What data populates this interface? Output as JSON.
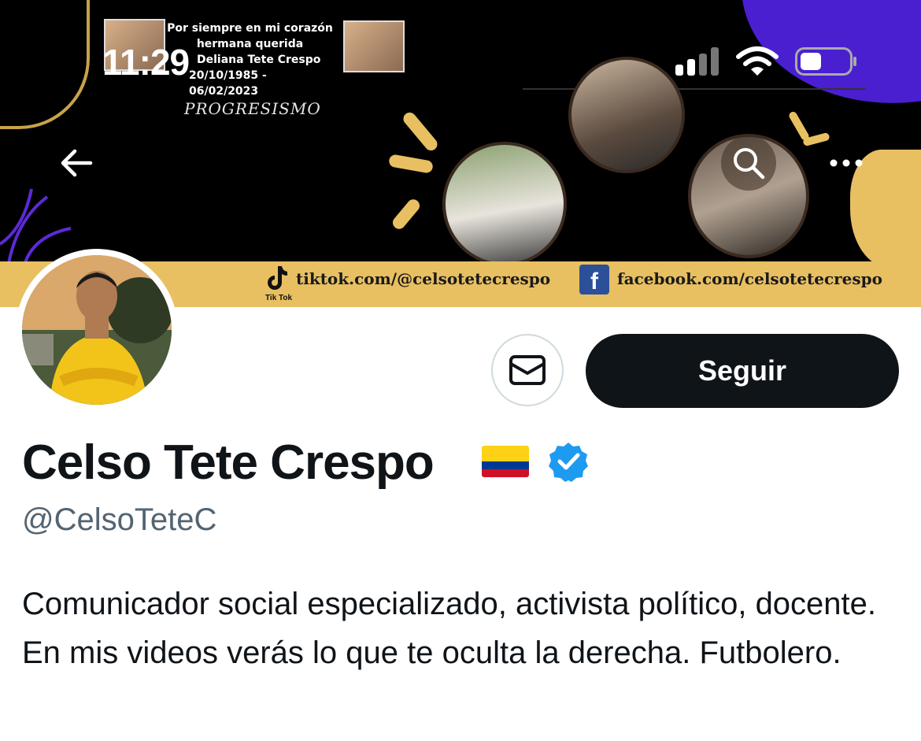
{
  "status_bar": {
    "time": "11:29"
  },
  "banner": {
    "memorial": {
      "line1": "Por siempre en mi corazón",
      "line2": "hermana querida",
      "line3": "Deliana Tete Crespo",
      "line4": "20/10/1985 - 06/02/2023"
    },
    "slogan": "PROGRESISMO",
    "tiktok_link": "tiktok.com/@celsotetecrespo",
    "tiktok_caption": "Tik Tok",
    "facebook_link": "facebook.com/celsotetecrespo"
  },
  "profile": {
    "display_name": "Celso Tete Crespo",
    "handle": "@CelsoTeteC",
    "bio": "Comunicador social especializado, activista político, docente. En mis videos verás lo que te oculta la derecha. Futbolero.",
    "follow_label": "Seguir",
    "verified": true
  },
  "icons": {
    "back": "arrow-left-icon",
    "search": "search-icon",
    "more": "more-horizontal-icon",
    "message": "mail-icon",
    "verified": "verified-badge-icon",
    "flag": "colombia-flag-icon"
  },
  "colors": {
    "follow_button": "#0f1419",
    "handle_text": "#536471",
    "verified_blue": "#1d9bf0",
    "banner_gold": "#e8c062"
  }
}
